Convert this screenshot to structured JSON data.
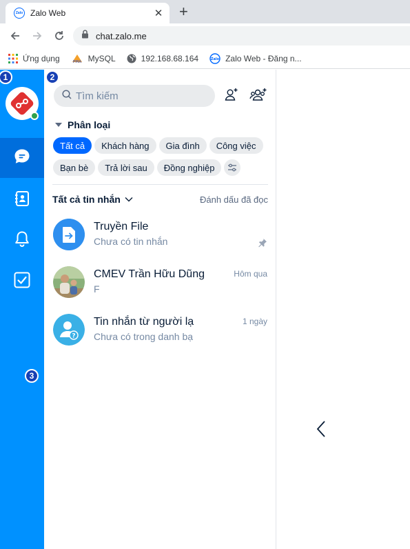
{
  "browser": {
    "tab_title": "Zalo Web",
    "tab_close": "✕",
    "new_tab": "+",
    "url": "chat.zalo.me",
    "favicon_text": "Zalo",
    "bookmarks": [
      {
        "label": "Ứng dụng",
        "icon": "apps-grid-icon"
      },
      {
        "label": "MySQL",
        "icon": "phpmyadmin-icon"
      },
      {
        "label": "192.168.68.164",
        "icon": "globe-icon"
      },
      {
        "label": "Zalo Web - Đăng n...",
        "icon": "zalo-icon"
      }
    ]
  },
  "annotations": [
    "1",
    "2",
    "3"
  ],
  "search": {
    "placeholder": "Tìm kiếm"
  },
  "filter": {
    "heading": "Phân loại",
    "chips_row1": [
      "Tất cả",
      "Khách hàng",
      "Gia đình",
      "Công việc"
    ],
    "chips_row2": [
      "Bạn bè",
      "Trả lời sau",
      "Đồng nghiệp"
    ]
  },
  "list": {
    "title": "Tất cả tin nhắn",
    "mark_read": "Đánh dấu đã đọc",
    "conversations": [
      {
        "name": "Truyền File",
        "preview": "Chưa có tin nhắn",
        "time": "",
        "pinned": true
      },
      {
        "name": "CMEV Trần Hữu Dũng",
        "preview": "F",
        "time": "Hôm qua",
        "pinned": false
      },
      {
        "name": "Tin nhắn từ người lạ",
        "preview": "Chưa có trong danh bạ",
        "time": "1 ngày",
        "pinned": false
      }
    ]
  },
  "colors": {
    "nav_blue": "#0091ff",
    "nav_active": "#006edc",
    "chip_active": "#0068ff",
    "online": "#30a14e"
  }
}
